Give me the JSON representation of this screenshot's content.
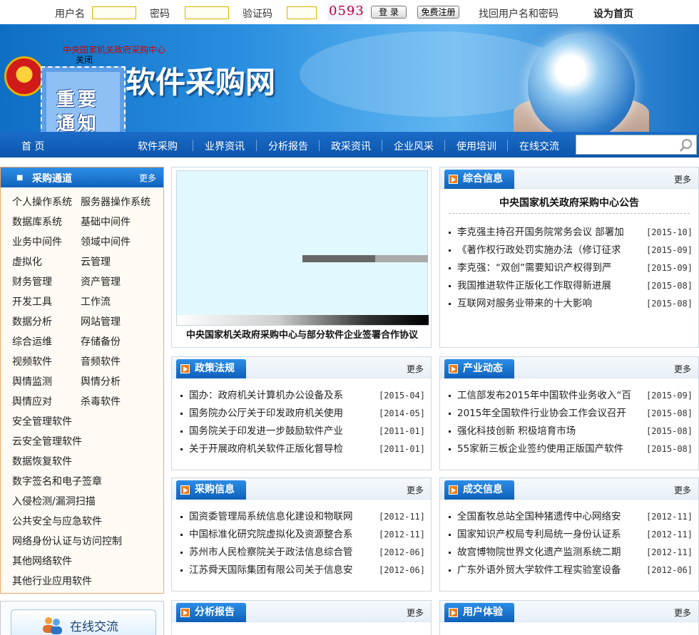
{
  "topbar": {
    "username_label": "用户名",
    "password_label": "密码",
    "captcha_label": "验证码",
    "captcha_text": "0593",
    "login_button": "登 录",
    "register_button": "免费注册",
    "recover_link": "找回用户名和密码",
    "homepage_link": "设为首页"
  },
  "banner": {
    "org_name": "中央国家机关政府采购中心",
    "site_name": "软件采购网",
    "close_label": "关闭"
  },
  "notice": {
    "line1": "重要",
    "line2": "通知"
  },
  "nav": {
    "items": [
      "首 页",
      "软件采购",
      "业界资讯",
      "分析报告",
      "政采资讯",
      "企业风采",
      "使用培训",
      "在线交流"
    ]
  },
  "channel": {
    "title": "采购通道",
    "more": "更多",
    "categories": [
      [
        "个人操作系统",
        "服务器操作系统"
      ],
      [
        "数据库系统",
        "基础中间件"
      ],
      [
        "业务中间件",
        "领域中间件"
      ],
      [
        "虚拟化",
        "云管理"
      ],
      [
        "财务管理",
        "资产管理"
      ],
      [
        "开发工具",
        "工作流"
      ],
      [
        "数据分析",
        "网站管理"
      ],
      [
        "综合运维",
        "存储备份"
      ],
      [
        "视频软件",
        "音频软件"
      ],
      [
        "舆情监测",
        "舆情分析"
      ],
      [
        "舆情应对",
        "杀毒软件"
      ],
      [
        "安全管理软件"
      ],
      [
        "云安全管理软件"
      ],
      [
        "数据恢复软件"
      ],
      [
        "数字签名和电子签章"
      ],
      [
        "入侵检测/漏洞扫描"
      ],
      [
        "公共安全与应急软件"
      ],
      [
        "网络身份认证与访问控制"
      ],
      [
        "其他网络软件"
      ],
      [
        "其他行业应用软件"
      ]
    ]
  },
  "online": {
    "label": "在线交流"
  },
  "slide": {
    "caption": "中央国家机关政府采购中心与部分软件企业签署合作协议"
  },
  "panels": {
    "general": {
      "title": "综合信息",
      "more": "更多",
      "notice_title": "中央国家机关政府采购中心公告",
      "items": [
        {
          "t": "李克强主持召开国务院常务会议 部署加",
          "d": "[2015-10]"
        },
        {
          "t": "《著作权行政处罚实施办法（修订征求",
          "d": "[2015-09]"
        },
        {
          "t": "李克强：“双创”需要知识产权得到严",
          "d": "[2015-09]"
        },
        {
          "t": "我国推进软件正版化工作取得新进展",
          "d": "[2015-08]"
        },
        {
          "t": "互联网对服务业带来的十大影响",
          "d": "[2015-08]"
        }
      ]
    },
    "policy": {
      "title": "政策法规",
      "more": "更多",
      "items": [
        {
          "t": "国办：政府机关计算机办公设备及系",
          "d": "[2015-04]"
        },
        {
          "t": "国务院办公厅关于印发政府机关使用",
          "d": "[2014-05]"
        },
        {
          "t": "国务院关于印发进一步鼓励软件产业",
          "d": "[2011-01]"
        },
        {
          "t": "关于开展政府机关软件正版化督导检",
          "d": "[2011-01]"
        }
      ]
    },
    "industry": {
      "title": "产业动态",
      "more": "更多",
      "items": [
        {
          "t": "工信部发布2015年中国软件业务收入“百",
          "d": "[2015-09]"
        },
        {
          "t": "2015年全国软件行业协会工作会议召开",
          "d": "[2015-08]"
        },
        {
          "t": "强化科技创新 积极培育市场",
          "d": "[2015-08]"
        },
        {
          "t": "55家新三板企业签约使用正版国产软件",
          "d": "[2015-08]"
        }
      ]
    },
    "procurement": {
      "title": "采购信息",
      "more": "更多",
      "items": [
        {
          "t": "国资委管理局系统信息化建设和物联网",
          "d": "[2012-11]"
        },
        {
          "t": "中国标准化研究院虚拟化及资源整合系",
          "d": "[2012-11]"
        },
        {
          "t": "苏州市人民检察院关于政法信息综合管",
          "d": "[2012-06]"
        },
        {
          "t": "江苏舜天国际集团有限公司关于信息安",
          "d": "[2012-06]"
        }
      ]
    },
    "deals": {
      "title": "成交信息",
      "more": "更多",
      "items": [
        {
          "t": "全国畜牧总站全国种猪遗传中心网络安",
          "d": "[2012-11]"
        },
        {
          "t": "国家知识产权局专利局统一身份认证系",
          "d": "[2012-11]"
        },
        {
          "t": "故宫博物院世界文化遗产监测系统二期",
          "d": "[2012-11]"
        },
        {
          "t": "广东外语外贸大学软件工程实验室设备",
          "d": "[2012-06]"
        }
      ]
    },
    "analysis": {
      "title": "分析报告",
      "more": "更多"
    },
    "experience": {
      "title": "用户体验",
      "more": "更多"
    }
  }
}
